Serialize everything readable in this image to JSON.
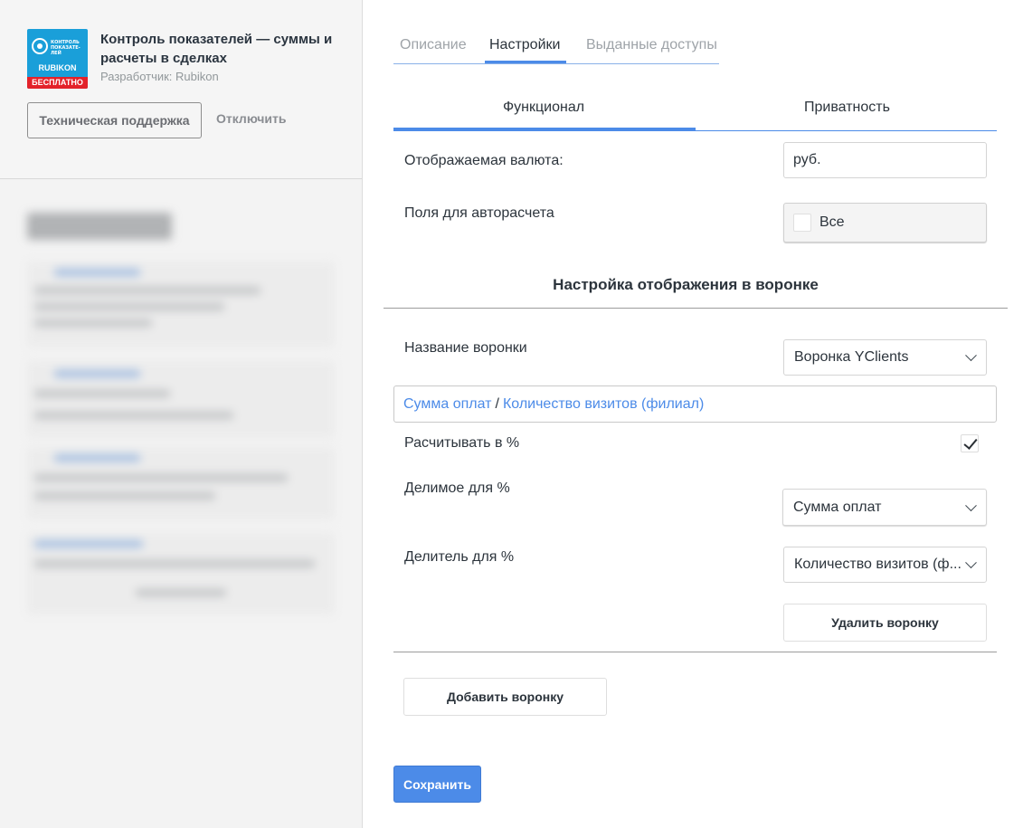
{
  "app": {
    "title": "Контроль показателей — суммы и расчеты в сделках",
    "developer": "Разработчик: Rubikon",
    "logo_small_text": "КОНТРОЛЬ ПОКАЗАТЕ- ЛЕЙ",
    "logo_brand": "RUBIKON",
    "logo_badge": "БЕСПЛАТНО",
    "support_button": "Техническая поддержка",
    "disable_button": "Отключить"
  },
  "tabs": [
    {
      "label": "Описание",
      "active": false
    },
    {
      "label": "Настройки",
      "active": true
    },
    {
      "label": "Выданные доступы",
      "active": false
    }
  ],
  "subtabs": [
    {
      "label": "Функционал",
      "active": true
    },
    {
      "label": "Приватность",
      "active": false
    }
  ],
  "settings": {
    "currency_label": "Отображаемая валюта:",
    "currency_value": "руб.",
    "autocalc_label": "Поля для авторасчета",
    "autocalc_value": "Все"
  },
  "funnel_section": {
    "title": "Настройка отображения в воронке",
    "funnel_name_label": "Название воронки",
    "funnel_name_value": "Воронка YClients",
    "formula_numerator": "Сумма оплат",
    "formula_separator": "/",
    "formula_denominator": "Количество визитов (филиал)",
    "percent_label": "Расчитывать в %",
    "percent_checked": true,
    "dividend_label": "Делимое для %",
    "dividend_value": "Сумма оплат",
    "divisor_label": "Делитель для %",
    "divisor_value": "Количество визитов (ф...",
    "delete_button": "Удалить воронку",
    "add_button": "Добавить воронку"
  },
  "save_button": "Сохранить",
  "colors": {
    "accent": "#4c8be8",
    "logo_bg": "#1a9fd9",
    "badge_red": "#e3222a"
  }
}
